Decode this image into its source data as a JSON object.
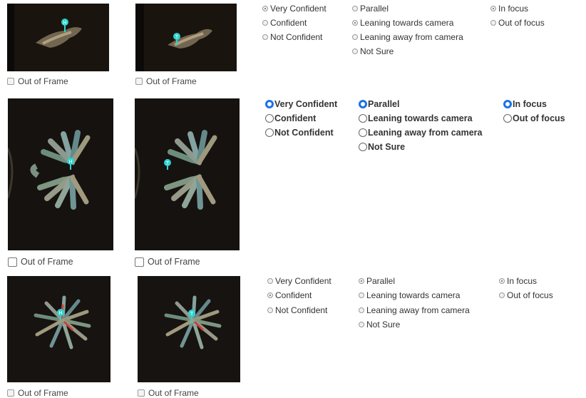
{
  "rows": [
    {
      "out_of_frame_label": "Out of Frame",
      "head_marker": "H",
      "tail_marker": "T",
      "confidence": [
        "Very Confident",
        "Confident",
        "Not Confident"
      ],
      "confidence_selected": 0,
      "orientation": [
        "Parallel",
        "Leaning towards camera",
        "Leaning away from camera",
        "Not Sure"
      ],
      "orientation_selected": 1,
      "focus": [
        "In focus",
        "Out of focus"
      ],
      "focus_selected": 0
    },
    {
      "out_of_frame_label": "Out of Frame",
      "head_marker": "H",
      "tail_marker": "T",
      "confidence": [
        "Very Confident",
        "Confident",
        "Not Confident"
      ],
      "confidence_selected": 0,
      "orientation": [
        "Parallel",
        "Leaning towards camera",
        "Leaning away from camera",
        "Not Sure"
      ],
      "orientation_selected": 0,
      "focus": [
        "In focus",
        "Out of focus"
      ],
      "focus_selected": 0
    },
    {
      "out_of_frame_label": "Out of Frame",
      "head_marker": "H",
      "tail_marker": "T",
      "confidence": [
        "Very Confident",
        "Confident",
        "Not Confident"
      ],
      "confidence_selected": 1,
      "orientation": [
        "Parallel",
        "Leaning towards camera",
        "Leaning away from camera",
        "Not Sure"
      ],
      "orientation_selected": 0,
      "focus": [
        "In focus",
        "Out of focus"
      ],
      "focus_selected": 0
    }
  ],
  "colors": {
    "marker": "#2fd3d0",
    "selected_radio": "#1a73e8",
    "image_bg": "#14100c"
  }
}
